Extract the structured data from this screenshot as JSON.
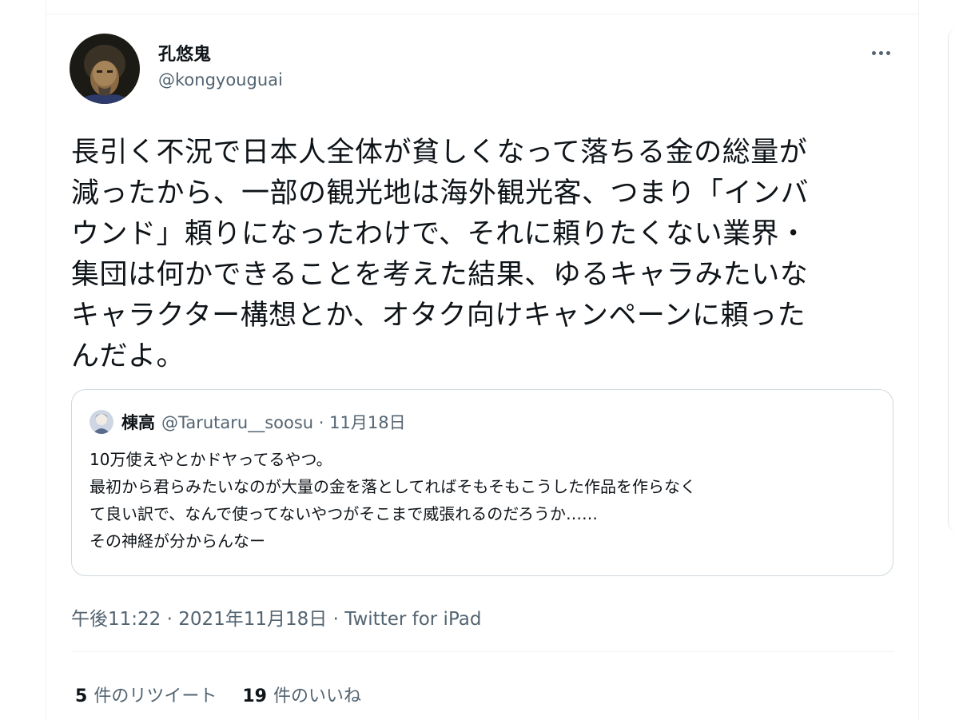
{
  "tweet": {
    "author": {
      "display_name": "孔悠鬼",
      "handle": "@kongyouguai"
    },
    "text_lines": [
      "長引く不況で日本人全体が貧しくなって落ちる金の総量が",
      "減ったから、一部の観光地は海外観光客、つまり「インバ",
      "ウンド」頼りになったわけで、それに頼りたくない業界・",
      "集団は何かできることを考えた結果、ゆるキャラみたいな",
      "キャラクター構想とか、オタク向けキャンペーンに頼った",
      "んだよ。"
    ],
    "timestamp": "午後11:22 · 2021年11月18日 · Twitter for iPad",
    "retweets": {
      "count": "5",
      "label": "件のリツイート"
    },
    "likes": {
      "count": "19",
      "label": "件のいいね"
    }
  },
  "quoted_tweet": {
    "display_name": "棟高",
    "meta": "@Tarutaru__soosu · 11月18日",
    "lines": [
      "10万使えやとかドヤってるやつ。",
      "最初から君らみたいなのが大量の金を落としてればそもそもこうした作品を作らなく",
      "て良い訳で、なんで使ってないやつがそこまで威張れるのだろうか……",
      "その神経が分からんなー"
    ]
  },
  "icons": {
    "more": "more-horizontal-icon",
    "avatar": "avatar-portrait",
    "quoted_avatar": "avatar-small"
  },
  "colors": {
    "text": "#0f1419",
    "secondary": "#536471",
    "border": "#cfd9de"
  }
}
